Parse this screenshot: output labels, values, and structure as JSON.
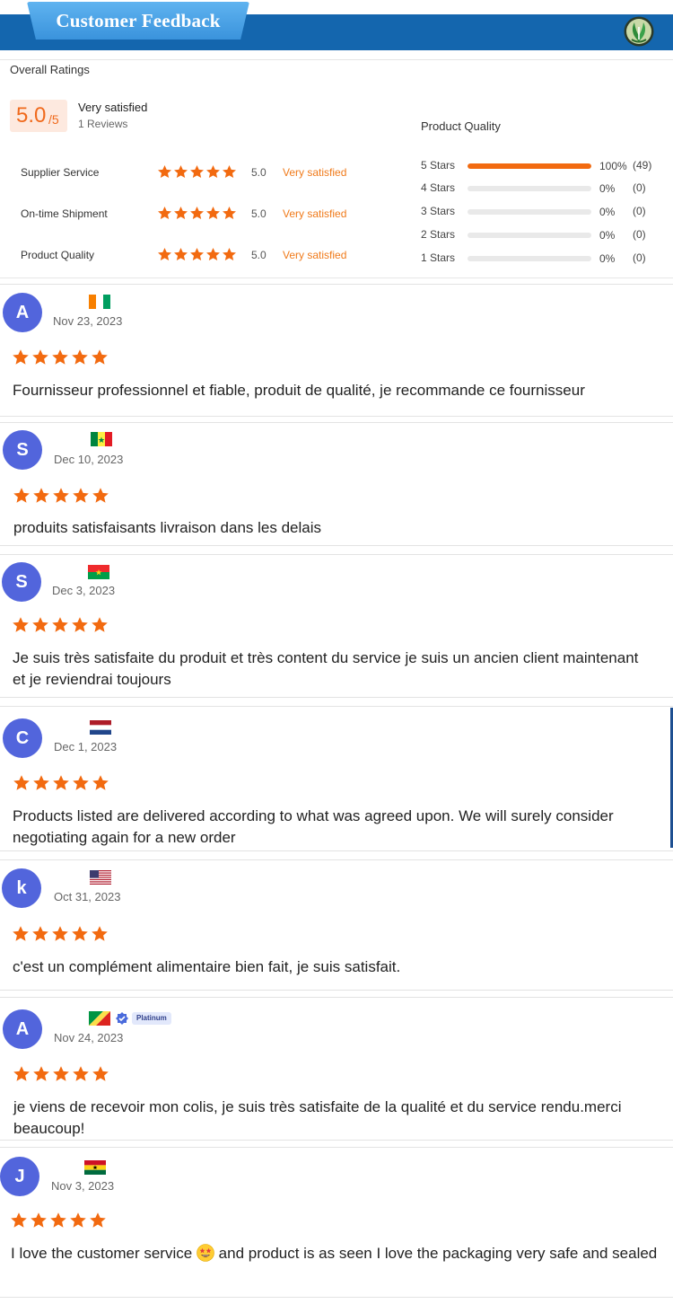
{
  "header": {
    "title": "Customer Feedback",
    "logo_icon": "leaf-logo-icon"
  },
  "summary": {
    "overall_label": "Overall Ratings",
    "score": "5.0",
    "score_max": "/5",
    "verdict": "Very satisfied",
    "review_count": "1 Reviews",
    "metrics": [
      {
        "label": "Supplier Service",
        "rating": 5,
        "score": "5.0",
        "verdict": "Very satisfied"
      },
      {
        "label": "On-time Shipment",
        "rating": 5,
        "score": "5.0",
        "verdict": "Very satisfied"
      },
      {
        "label": "Product Quality",
        "rating": 5,
        "score": "5.0",
        "verdict": "Very satisfied"
      }
    ],
    "product_quality_label": "Product Quality",
    "distribution": [
      {
        "label": "5 Stars",
        "fraction": 1.0,
        "pct": "100%",
        "count": "(49)"
      },
      {
        "label": "4 Stars",
        "fraction": 0,
        "pct": "0%",
        "count": "(0)"
      },
      {
        "label": "3 Stars",
        "fraction": 0,
        "pct": "0%",
        "count": "(0)"
      },
      {
        "label": "2 Stars",
        "fraction": 0,
        "pct": "0%",
        "count": "(0)"
      },
      {
        "label": "1 Stars",
        "fraction": 0,
        "pct": "0%",
        "count": "(0)"
      }
    ]
  },
  "colors": {
    "accent": "#f26a10",
    "header": "#1466ae",
    "avatar": "#5265dc",
    "star": "#f26a10"
  },
  "reviews": [
    {
      "initial": "A",
      "flag": "ivory-coast-flag",
      "date": "Nov 23, 2023",
      "rating": 5,
      "text": "Fournisseur professionnel et fiable, produit de qualité, je recommande ce fournisseur"
    },
    {
      "initial": "S",
      "flag": "senegal-flag",
      "date": "Dec 10, 2023",
      "rating": 5,
      "text": "produits satisfaisants livraison dans les delais"
    },
    {
      "initial": "S",
      "flag": "burkina-faso-flag",
      "date": "Dec 3, 2023",
      "rating": 5,
      "text": "Je suis très satisfaite du produit et très content du service je suis un ancien client maintenant et je reviendrai toujours"
    },
    {
      "initial": "C",
      "flag": "netherlands-flag",
      "date": "Dec 1, 2023",
      "rating": 5,
      "text": "Products listed are delivered according to what was agreed upon. We will surely consider negotiating again for a new order"
    },
    {
      "initial": "k",
      "flag": "usa-flag",
      "date": "Oct 31, 2023",
      "rating": 5,
      "text": "c'est un complément alimentaire bien fait, je suis satisfait."
    },
    {
      "initial": "A",
      "flag": "congo-flag",
      "date": "Nov 24, 2023",
      "rating": 5,
      "badge": "Platinum",
      "text": "je viens de recevoir mon colis, je suis très satisfaite de la qualité et du service rendu.merci beaucoup!"
    },
    {
      "initial": "J",
      "flag": "ghana-flag",
      "date": "Nov 3, 2023",
      "rating": 5,
      "text_before": "I love the customer service",
      "emoji": "star-struck-emoji",
      "text_after": "and product is as seen I love the packaging very safe and sealed"
    }
  ]
}
